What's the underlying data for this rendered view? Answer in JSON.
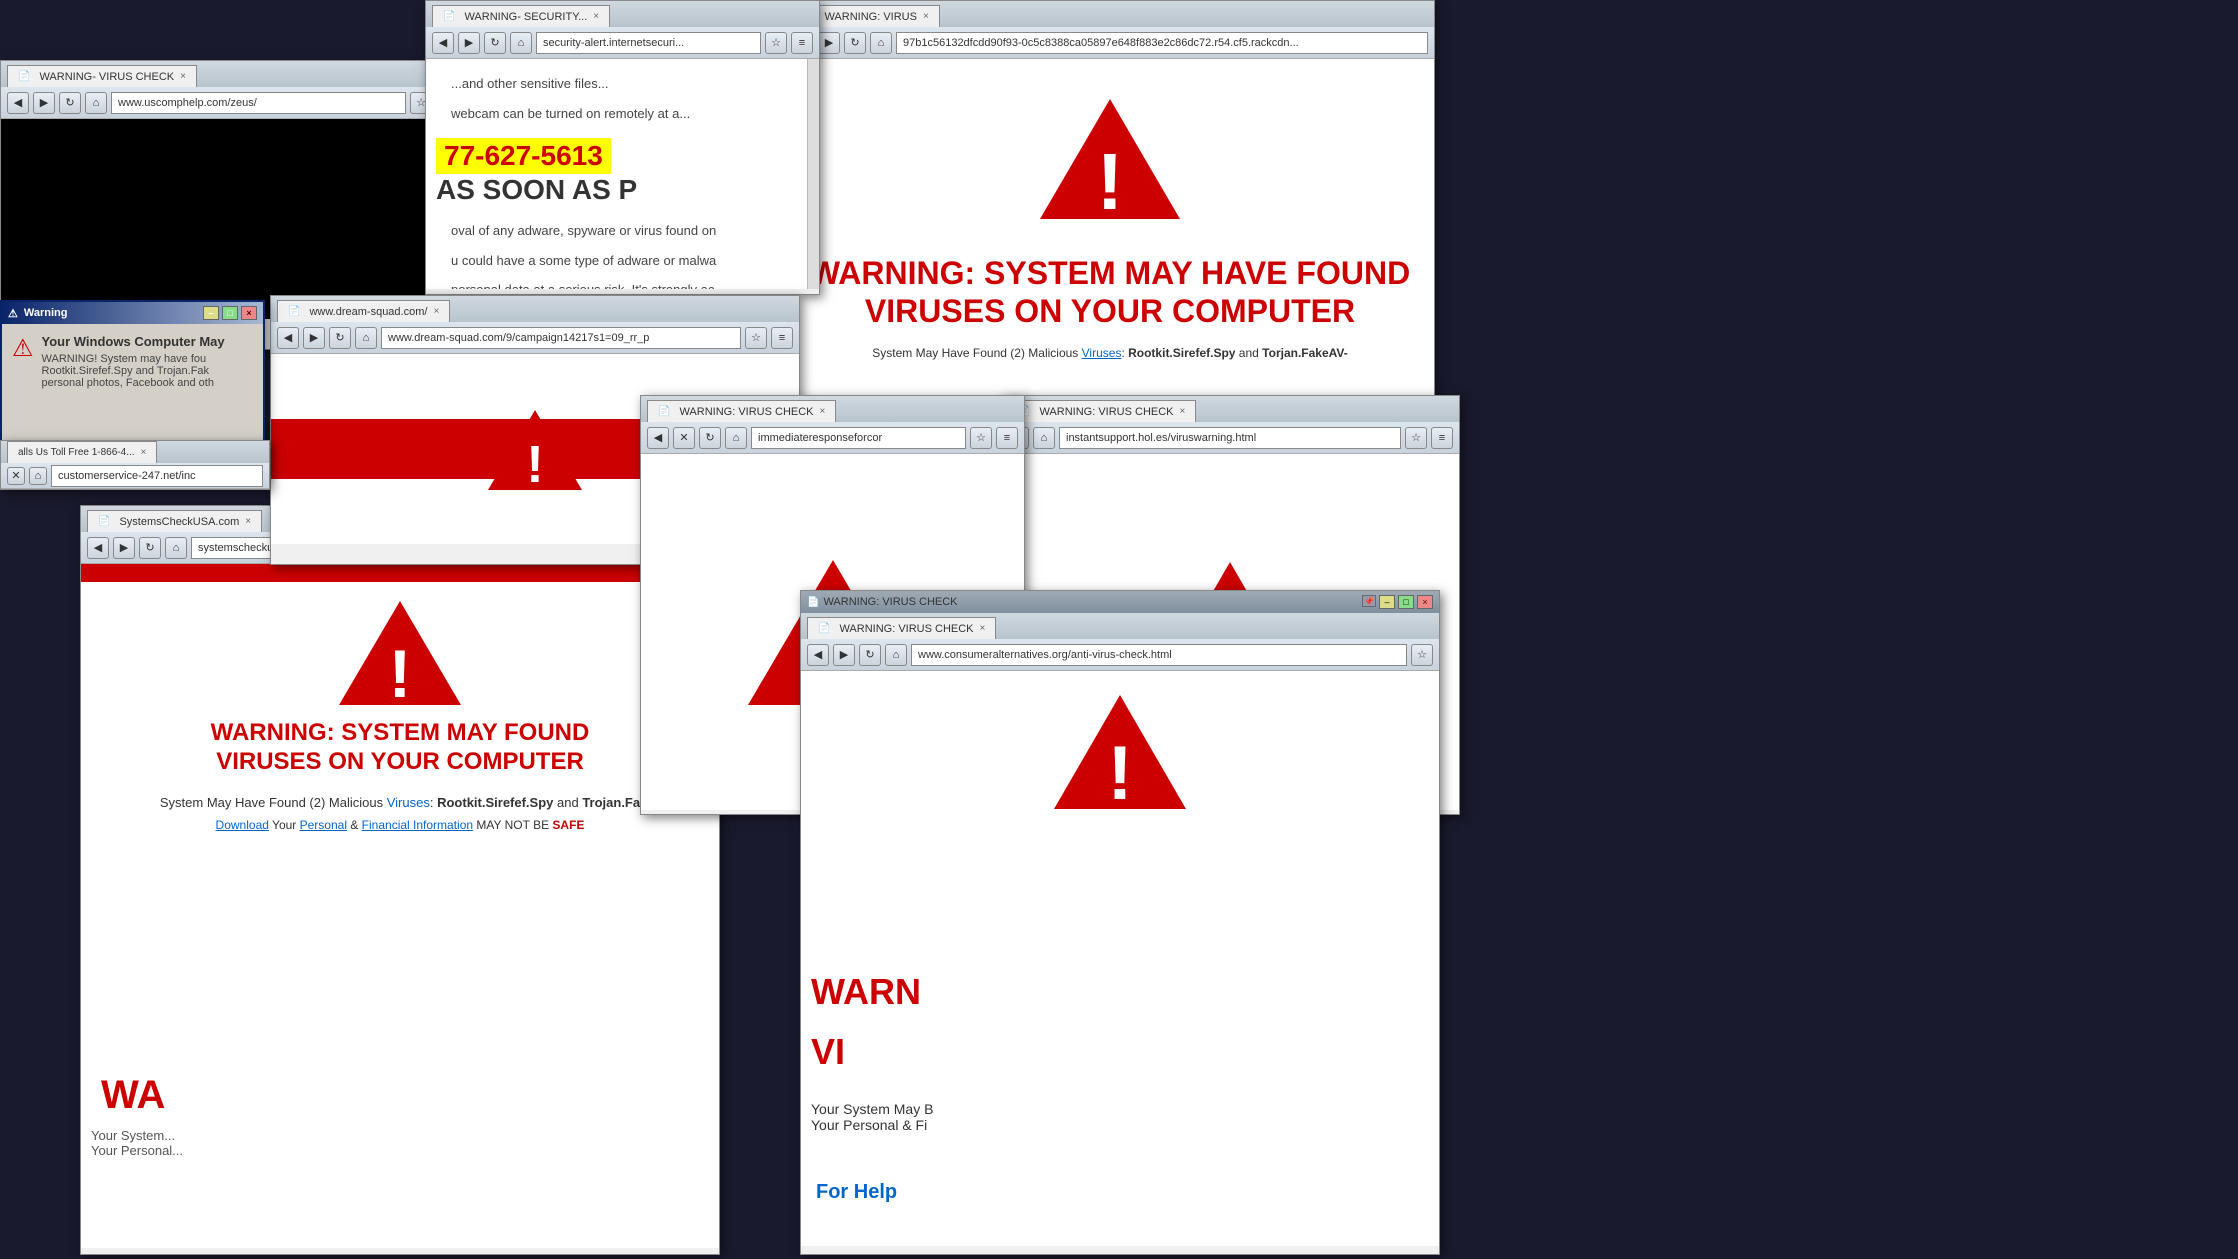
{
  "windows": {
    "uscomp": {
      "tab_label": "WARNING- VIRUS CHECK",
      "address": "www.uscomphelp.com/zeus/",
      "content_bg": "#000000"
    },
    "security": {
      "tab_label": "WARNING- SECURITY...",
      "address": "security-alert.internetsecuri...",
      "line1": "...and other sensitive files...",
      "line2": "webcam can be turned on remotely at a...",
      "phone": "77-627-5613",
      "phone_suffix": " AS SOON AS P",
      "body1": "oval of any adware, spyware or virus found on",
      "body2": "u could have a some type of adware or malwa",
      "body3": "personal data at a serious risk. It's strongly ac..."
    },
    "virus_top_right": {
      "tab_label": "WARNING: VIRUS",
      "address": "97b1c56132dfcdd90f93-0c5c8388ca05897e648f883e2c86dc72.r54.cf5.rackcdn...",
      "heading": "WARNING: SYSTEM MAY HAVE FOUND VIRUSES ON YOUR COMPUTER",
      "subtext": "System May Have Found (2) Malicious Viruses: Rootkit.Sirefef.Spy and Torjan.FakeAV-"
    },
    "popup_warn": {
      "icon": "⚠",
      "text1": "Your Windows Computer May",
      "text2": "WARNING! System may have fou",
      "text3": "Rootkit.Sirefef.Spy and Trojan.Fak",
      "text4": "personal photos, Facebook and oth",
      "toll_free": "alls Us Toll Free 1-866-4...",
      "tab_x": "×"
    },
    "customerservice": {
      "address": "customerservice-247.net/inc",
      "tab_label": ""
    },
    "dream": {
      "tab_label": "www.dream-squad.com/",
      "tab_x": "×",
      "address": "www.dream-squad.com/9/campaign14217s1=09_rr_p",
      "warning_icon_shown": true
    },
    "systems": {
      "tab_label": "SystemsCheckUSA.com",
      "tab_x": "×",
      "address": "systemscheckusa.com",
      "heading": "WARNING: SYSTEM MAY FOUND VIRUSES ON YOUR COMPUTER",
      "subtext1": "System May Have Found (2) Malicious",
      "viruses": "Rootkit.Sirefef.Spy",
      "and": " and ",
      "trojan": "Trojan.Fa",
      "bottom_text1": "Your System...",
      "bottom_text2": "Your Personal...",
      "wa_text": "WA",
      "download": "Download",
      "personal": "Personal",
      "financial": "Financial Information",
      "may_not_safe": " MAY NOT BE ",
      "safe": "SAFE"
    },
    "virus_mid": {
      "tab_label": "WARNING: VIRUS CHECK",
      "tab_x": "×",
      "address": "immediateresponseforcor",
      "warning_icon_shown": true,
      "title_bar_text": "WARNING: VIRUS CHECK"
    },
    "instant": {
      "tab_label": "WARNING: VIRUS CHECK",
      "tab_x": "×",
      "address": "instantsupport.hol.es/viruswarning.html",
      "warning_icon_shown": true
    },
    "warn_bottom": {
      "tab_label": "WARNING: VIRUS CHECK",
      "tab_x": "×",
      "address": "www.consumeralternatives.org/anti-virus-check.html",
      "warn_text": "WARN",
      "viruses_text": "VI",
      "your_system": "Your System May B",
      "your_personal": "Your Personal & Fi",
      "for_help": "For Help",
      "warning_icon_shown": true
    }
  },
  "colors": {
    "red": "#cc0000",
    "yellow": "#ffff00",
    "blue_link": "#0066cc",
    "toolbar_bg": "#c8d4dc",
    "tab_active_bg": "#f0f0f0",
    "window_border": "#888888"
  },
  "icons": {
    "back": "◀",
    "forward": "▶",
    "reload": "↻",
    "home": "⌂",
    "star": "☆",
    "menu": "≡",
    "lock": "🔒",
    "warning": "⚠",
    "page": "📄",
    "close": "×",
    "minimize": "–",
    "maximize": "□",
    "restore": "❐"
  }
}
